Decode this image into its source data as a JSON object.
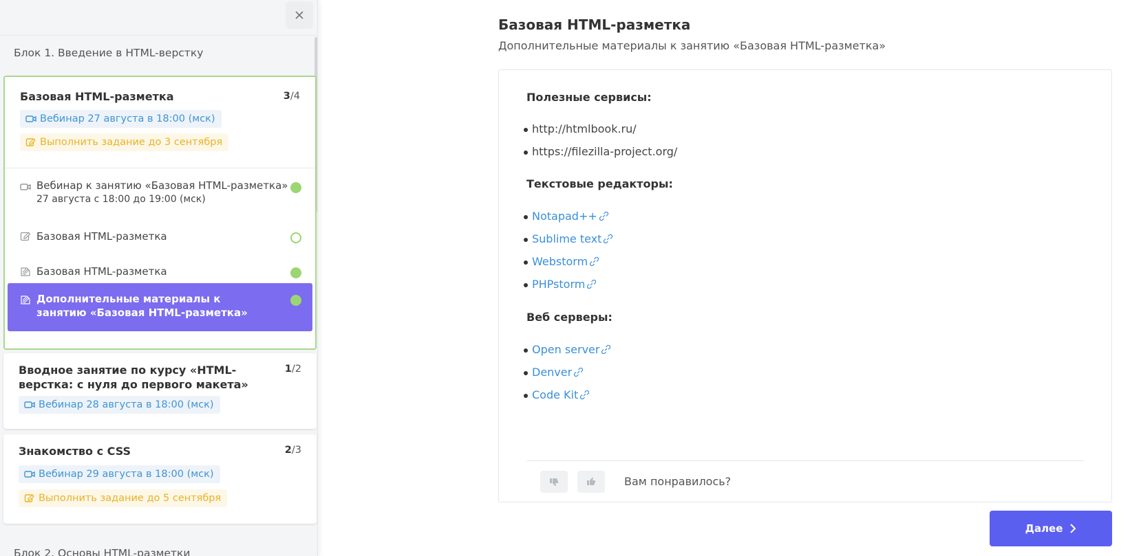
{
  "sidebar": {
    "block1_title": "Блок 1. Введение в HTML-верстку",
    "block2_title": "Блок 2. Основы HTML-разметки",
    "lessons": [
      {
        "title": "Базовая HTML-разметка",
        "count_done": "3",
        "count_total": "/4",
        "webinar_badge": "Вебинар 27 августа в 18:00 (мск)",
        "task_badge": "Выполнить задание до 3 сентября",
        "items": [
          {
            "title": "Вебинар к занятию «Базовая HTML-разметка»",
            "subtitle": "27 августа с 18:00 до 19:00 (мск)",
            "icon": "video-icon",
            "status": "done"
          },
          {
            "title": "Базовая HTML-разметка",
            "icon": "edit-icon",
            "status": "pending"
          },
          {
            "title": "Базовая HTML-разметка",
            "icon": "material-icon",
            "status": "done"
          },
          {
            "title": "Дополнительные материалы к занятию «Базовая HTML-разметка»",
            "icon": "material-icon",
            "status": "done",
            "selected": true
          }
        ]
      },
      {
        "title": "Вводное занятие по курсу «HTML-верстка: с нуля до первого макета»",
        "count_done": "1",
        "count_total": "/2",
        "webinar_badge": "Вебинар 28 августа в 18:00 (мск)"
      },
      {
        "title": "Знакомство с CSS",
        "count_done": "2",
        "count_total": "/3",
        "webinar_badge": "Вебинар 29 августа в 18:00 (мск)",
        "task_badge": "Выполнить задание до 5 сентября"
      }
    ]
  },
  "main": {
    "title": "Базовая HTML-разметка",
    "subtitle": "Дополнительные материалы к занятию «Базовая HTML-разметка»",
    "sections": [
      {
        "heading": "Полезные сервисы:",
        "items": [
          "http://htmlbook.ru/",
          "https://filezilla-project.org/"
        ]
      },
      {
        "heading": "Текстовые редакторы:",
        "items": [
          "Notapad++",
          "Sublime text",
          "Webstorm",
          "PHPstorm"
        ]
      },
      {
        "heading": "Веб серверы:",
        "items": [
          "Open server",
          "Denver",
          "Code Kit"
        ]
      }
    ],
    "feedback_question": "Вам понравилось?",
    "next_label": "Далее"
  },
  "colors": {
    "accent_purple": "#7b6cf0",
    "next_button": "#5b5ff0",
    "link_blue": "#3a8fd8",
    "status_green": "#9cd672",
    "badge_yellow": "#e8b324"
  }
}
